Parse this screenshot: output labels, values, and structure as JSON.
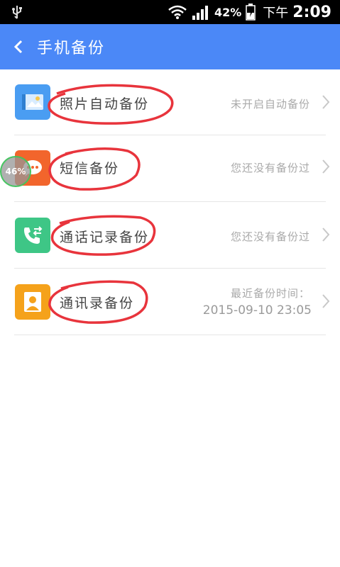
{
  "status_bar": {
    "battery_percent": "42%",
    "ampm": "下午",
    "time": "2:09"
  },
  "header": {
    "title": "手机备份"
  },
  "items": [
    {
      "label": "照片自动备份",
      "status": "未开启自动备份",
      "icon": "photo-icon",
      "color": "#4a9df2"
    },
    {
      "label": "短信备份",
      "status": "您还没有备份过",
      "icon": "message-icon",
      "color": "#f2652c"
    },
    {
      "label": "通话记录备份",
      "status": "您还没有备份过",
      "icon": "phone-icon",
      "color": "#3ec686"
    },
    {
      "label": "通讯录备份",
      "status_line1": "最近备份时间：",
      "status_line2": "2015-09-10 23:05",
      "icon": "contact-icon",
      "color": "#f5a21b"
    }
  ],
  "floating_badge": "46%",
  "colors": {
    "accent": "#4b88f7",
    "annotation": "#e8343c"
  }
}
